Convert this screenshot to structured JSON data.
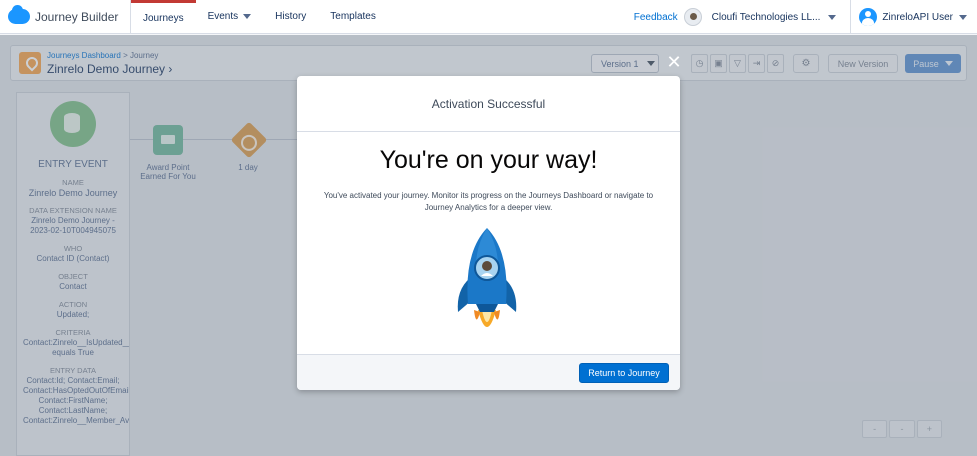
{
  "app": {
    "title": "Journey Builder"
  },
  "nav": {
    "tabs": [
      {
        "label": "Journeys"
      },
      {
        "label": "Events"
      },
      {
        "label": "History"
      },
      {
        "label": "Templates"
      }
    ],
    "feedback": "Feedback",
    "org": "Cloufi Technologies LL...",
    "user": "ZinreloAPI User"
  },
  "header": {
    "breadcrumb_link": "Journeys Dashboard",
    "breadcrumb_sep": ">",
    "breadcrumb_current": "Journey",
    "journey_name": "Zinrelo Demo Journey",
    "journey_chevron": "›",
    "version": "Version 1",
    "new_version": "New Version",
    "pause": "Pause"
  },
  "entry_event": {
    "title": "ENTRY EVENT",
    "fields": [
      {
        "label": "NAME",
        "value": "Zinrelo Demo Journey"
      },
      {
        "label": "DATA EXTENSION NAME",
        "value": "Zinrelo Demo Journey - 2023-02-10T004945075"
      },
      {
        "label": "WHO",
        "value": "Contact ID (Contact)"
      },
      {
        "label": "OBJECT",
        "value": "Contact"
      },
      {
        "label": "ACTION",
        "value": "Updated;"
      },
      {
        "label": "CRITERIA",
        "value": "Contact:Zinrelo__IsUpdated__c equals True"
      },
      {
        "label": "ENTRY DATA",
        "value": "Contact:Id; Contact:Email; Contact:HasOptedOutOfEmail; Contact:FirstName; Contact:LastName; Contact:Zinrelo__Member_Available_Point__c;"
      }
    ]
  },
  "canvas": {
    "node1_label": "Award Point Earned For You",
    "node2_label": "1 day",
    "zoom": [
      "-",
      "-",
      "+"
    ]
  },
  "modal": {
    "title": "Activation Successful",
    "headline": "You're on your way!",
    "message": "You've activated your journey. Monitor its progress on the Journeys Dashboard or navigate to Journey Analytics for a deeper view.",
    "button": "Return to Journey",
    "close": "✕"
  },
  "colors": {
    "accent": "#0070d2",
    "active_tab": "#c23934",
    "entry_green": "#7dbd86",
    "rocket_blue": "#1b78c8"
  }
}
